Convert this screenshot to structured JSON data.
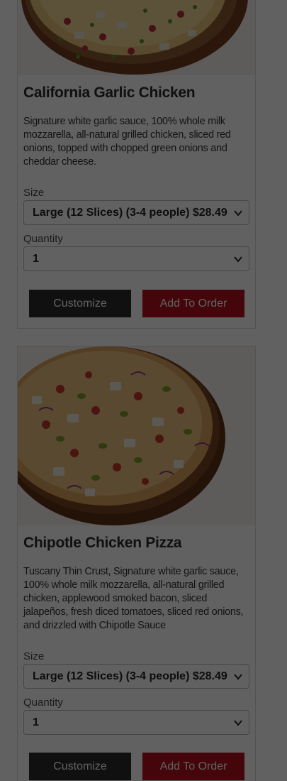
{
  "products": [
    {
      "name": "California Garlic Chicken",
      "description": "Signature white garlic sauce, 100% whole milk mozzarella, all-natural grilled chicken, sliced red onions, topped with chopped green onions and cheddar cheese.",
      "size_label": "Size",
      "size_value": "Large (12 Slices) (3-4 people) $28.49",
      "quantity_label": "Quantity",
      "quantity_value": "1",
      "customize_label": "Customize",
      "add_label": "Add To Order"
    },
    {
      "name": "Chipotle Chicken Pizza",
      "description": "Tuscany Thin Crust, Signature white garlic sauce, 100% whole milk mozzarella, all-natural grilled chicken, applewood smoked bacon, sliced jalapeños, fresh diced tomatoes, sliced red onions, and drizzled with Chipotle Sauce",
      "size_label": "Size",
      "size_value": "Large (12 Slices) (3-4 people) $28.49",
      "quantity_label": "Quantity",
      "quantity_value": "1",
      "customize_label": "Customize",
      "add_label": "Add To Order"
    }
  ],
  "colors": {
    "overlay": "#000000",
    "add_button": "#b3101c",
    "customize_button": "#2a2a2a"
  }
}
